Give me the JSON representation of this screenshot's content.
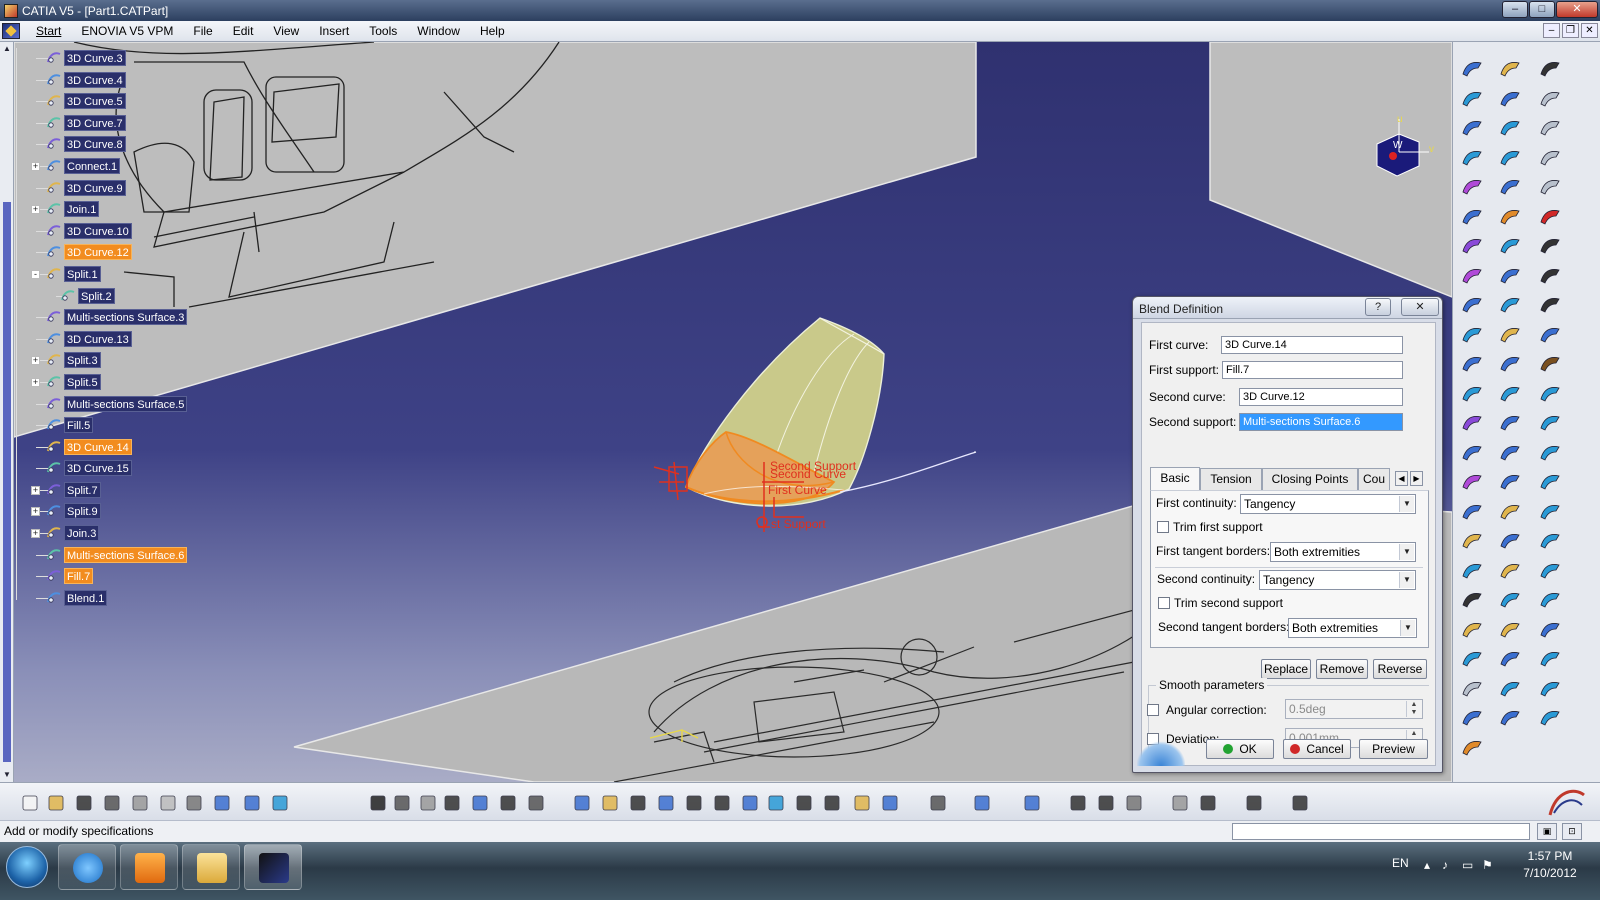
{
  "window": {
    "title": "CATIA V5 - [Part1.CATPart]"
  },
  "menubar": {
    "items": [
      "Start",
      "ENOVIA V5 VPM",
      "File",
      "Edit",
      "View",
      "Insert",
      "Tools",
      "Window",
      "Help"
    ]
  },
  "spec_tree": {
    "items": [
      {
        "label": "3D Curve.3",
        "expander": "",
        "highlight": false,
        "sub": false
      },
      {
        "label": "3D Curve.4",
        "expander": "",
        "highlight": false,
        "sub": false
      },
      {
        "label": "3D Curve.5",
        "expander": "",
        "highlight": false,
        "sub": false
      },
      {
        "label": "3D Curve.7",
        "expander": "",
        "highlight": false,
        "sub": false
      },
      {
        "label": "3D Curve.8",
        "expander": "",
        "highlight": false,
        "sub": false
      },
      {
        "label": "Connect.1",
        "expander": "+",
        "highlight": false,
        "sub": false
      },
      {
        "label": "3D Curve.9",
        "expander": "",
        "highlight": false,
        "sub": false
      },
      {
        "label": "Join.1",
        "expander": "+",
        "highlight": false,
        "sub": false
      },
      {
        "label": "3D Curve.10",
        "expander": "",
        "highlight": false,
        "sub": false
      },
      {
        "label": "3D Curve.12",
        "expander": "",
        "highlight": true,
        "sub": false
      },
      {
        "label": "Split.1",
        "expander": "-",
        "highlight": false,
        "sub": false
      },
      {
        "label": "Split.2",
        "expander": "",
        "highlight": false,
        "sub": true
      },
      {
        "label": "Multi-sections Surface.3",
        "expander": "",
        "highlight": false,
        "sub": false
      },
      {
        "label": "3D Curve.13",
        "expander": "",
        "highlight": false,
        "sub": false
      },
      {
        "label": "Split.3",
        "expander": "+",
        "highlight": false,
        "sub": false
      },
      {
        "label": "Split.5",
        "expander": "+",
        "highlight": false,
        "sub": false
      },
      {
        "label": "Multi-sections Surface.5",
        "expander": "",
        "highlight": false,
        "sub": false
      },
      {
        "label": "Fill.5",
        "expander": "",
        "highlight": false,
        "sub": false
      },
      {
        "label": "3D Curve.14",
        "expander": "",
        "highlight": true,
        "sub": false
      },
      {
        "label": "3D Curve.15",
        "expander": "",
        "highlight": false,
        "sub": false
      },
      {
        "label": "Split.7",
        "expander": "+",
        "highlight": false,
        "sub": false
      },
      {
        "label": "Split.9",
        "expander": "+",
        "highlight": false,
        "sub": false
      },
      {
        "label": "Join.3",
        "expander": "+",
        "highlight": false,
        "sub": false
      },
      {
        "label": "Multi-sections Surface.6",
        "expander": "",
        "highlight": true,
        "sub": false
      },
      {
        "label": "Fill.7",
        "expander": "",
        "highlight": true,
        "sub": false
      },
      {
        "label": "Blend.1",
        "expander": "",
        "highlight": false,
        "sub": false
      }
    ]
  },
  "viewport": {
    "annotations": [
      "Second Support",
      "Second Curve",
      "First Curve",
      "st Support"
    ],
    "compass": {
      "u": "u",
      "v": "v",
      "w": "W"
    }
  },
  "dialog": {
    "title": "Blend Definition",
    "help_btn": "?",
    "close_btn": "✕",
    "first_curve_label": "First curve:",
    "first_curve_value": "3D Curve.14",
    "first_support_label": "First support:",
    "first_support_value": "Fill.7",
    "second_curve_label": "Second curve:",
    "second_curve_value": "3D Curve.12",
    "second_support_label": "Second support:",
    "second_support_value": "Multi-sections Surface.6",
    "tabs": [
      "Basic",
      "Tension",
      "Closing Points",
      "Cou"
    ],
    "first_continuity_label": "First continuity:",
    "first_continuity_value": "Tangency",
    "trim_first_label": "Trim first support",
    "first_tangent_label": "First tangent borders:",
    "first_tangent_value": "Both extremities",
    "second_continuity_label": "Second continuity:",
    "second_continuity_value": "Tangency",
    "trim_second_label": "Trim second support",
    "second_tangent_label": "Second tangent borders:",
    "second_tangent_value": "Both extremities",
    "replace": "Replace",
    "remove": "Remove",
    "reverse": "Reverse",
    "smooth_title": "Smooth parameters",
    "angular_label": "Angular correction:",
    "angular_value": "0.5deg",
    "deviation_label": "Deviation:",
    "deviation_value": "0.001mm",
    "ok": "OK",
    "cancel": "Cancel",
    "preview": "Preview"
  },
  "status": {
    "text": "Add or modify specifications"
  },
  "taskbar": {
    "lang": "EN",
    "time": "1:57 PM",
    "date": "7/10/2012"
  },
  "colors": {
    "viewport_bg": "#3a3d7a",
    "highlight": "#f28c1f",
    "selection": "#3399ff",
    "surface": "#c9c98a"
  }
}
